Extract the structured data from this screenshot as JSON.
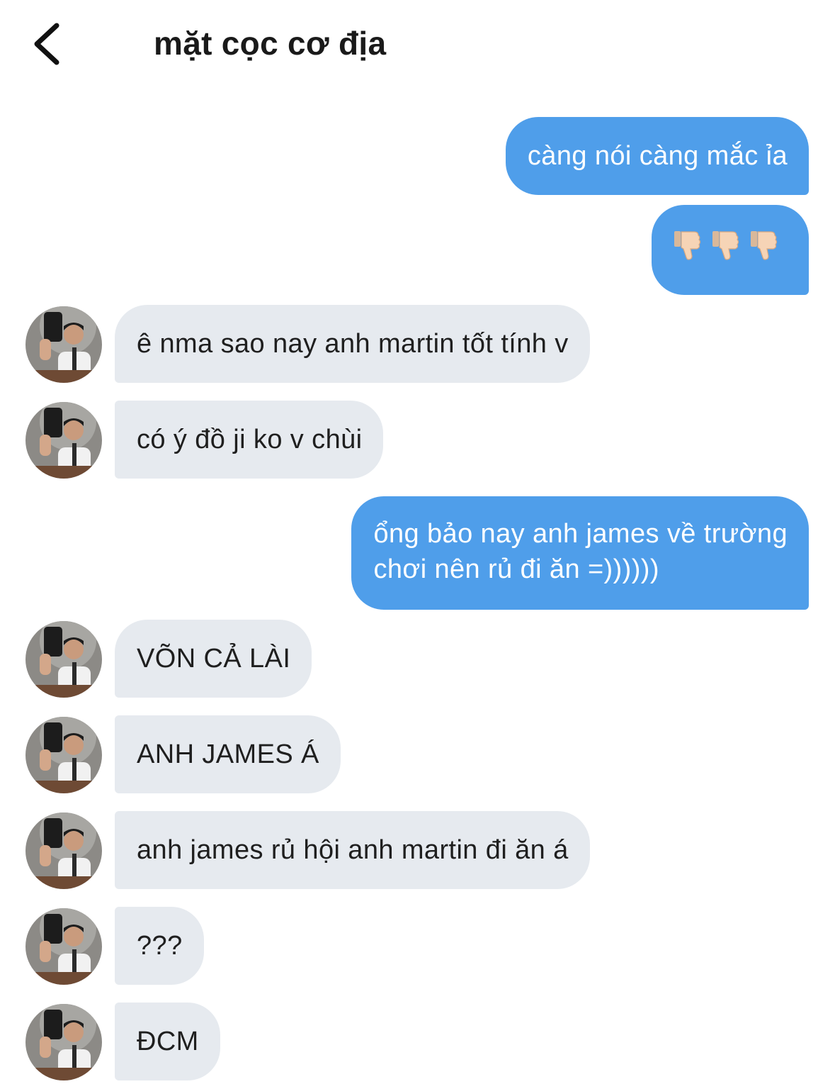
{
  "header": {
    "back_icon": "chevron-left-icon",
    "title": "mặt cọc cơ địa"
  },
  "messages": [
    {
      "sender": "me",
      "text": "càng nói càng mắc ỉa"
    },
    {
      "sender": "me",
      "text": "",
      "emoji": "thumbs-down-icon",
      "emoji_count": 3
    },
    {
      "sender": "other",
      "text": "ê nma sao nay anh martin tốt tính v"
    },
    {
      "sender": "other",
      "text": "có ý đồ ji ko v chùi"
    },
    {
      "sender": "me",
      "lines": [
        "ổng bảo nay anh james về trường",
        "chơi nên rủ đi ăn =))))))"
      ]
    },
    {
      "sender": "other",
      "text": "VÕN CẢ LÀI"
    },
    {
      "sender": "other",
      "text": "ANH JAMES Á"
    },
    {
      "sender": "other",
      "text": "anh james rủ hội anh martin đi ăn á"
    },
    {
      "sender": "other",
      "text": "???"
    },
    {
      "sender": "other",
      "text": "ĐCM"
    }
  ],
  "colors": {
    "outgoing_bubble": "#4f9eea",
    "incoming_bubble": "#e6eaef",
    "outgoing_text": "#ffffff",
    "incoming_text": "#1f1f1f"
  }
}
